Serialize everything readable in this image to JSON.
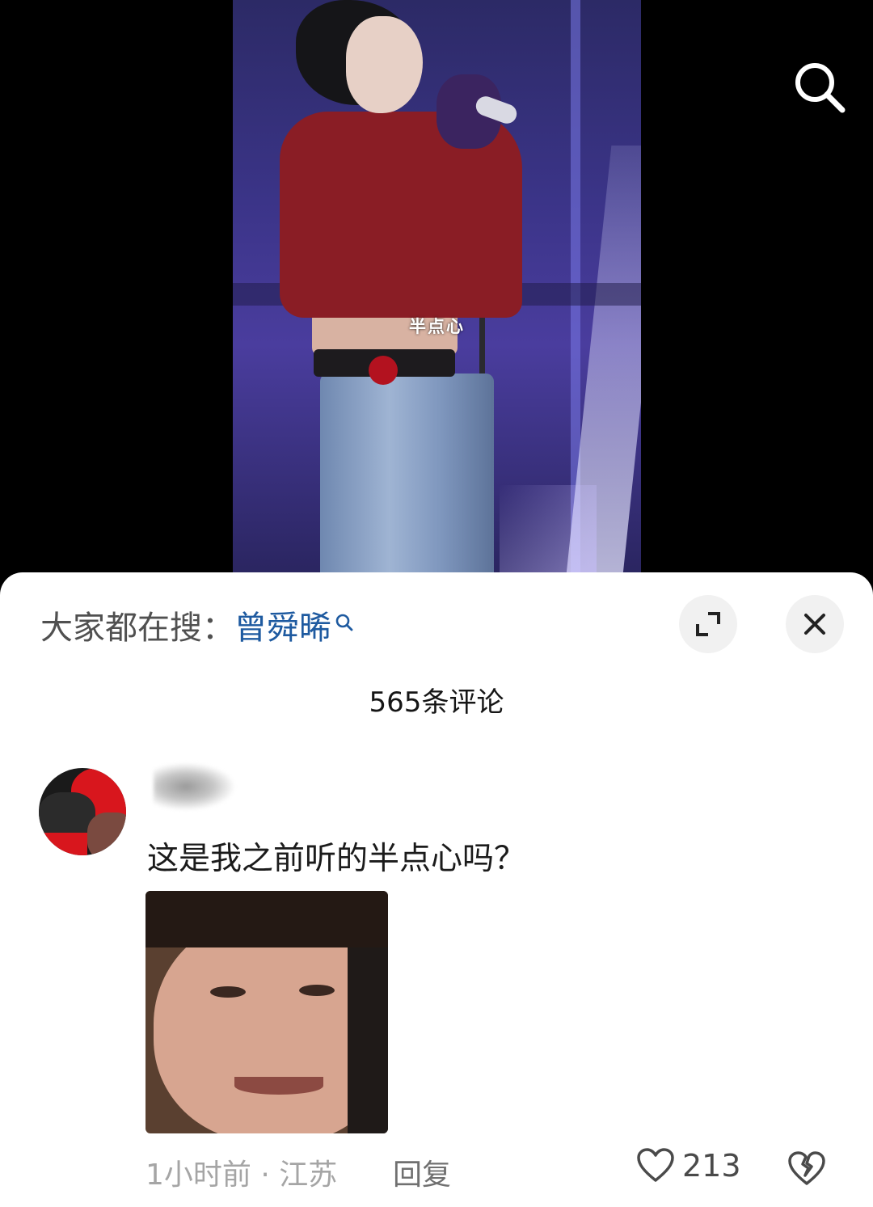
{
  "video": {
    "caption": "半点心"
  },
  "header": {
    "search_icon": "search-icon"
  },
  "sheet": {
    "trending_prefix": "大家都在搜：",
    "trending_keyword": "曾舜晞",
    "trending_keyword_icon": "search-small-icon",
    "expand_icon": "expand-icon",
    "close_icon": "close-icon",
    "comment_count": "565条评论"
  },
  "comment": {
    "text": "这是我之前听的半点心吗？",
    "time": "1小时前",
    "separator": " · ",
    "location": "江苏",
    "reply_label": "回复",
    "likes": "213",
    "like_icon": "heart-icon",
    "dislike_icon": "broken-heart-icon"
  },
  "colors": {
    "keyword": "#1e5aa0",
    "meta": "#a5a5a5",
    "background": "#000000",
    "sheet": "#ffffff"
  }
}
